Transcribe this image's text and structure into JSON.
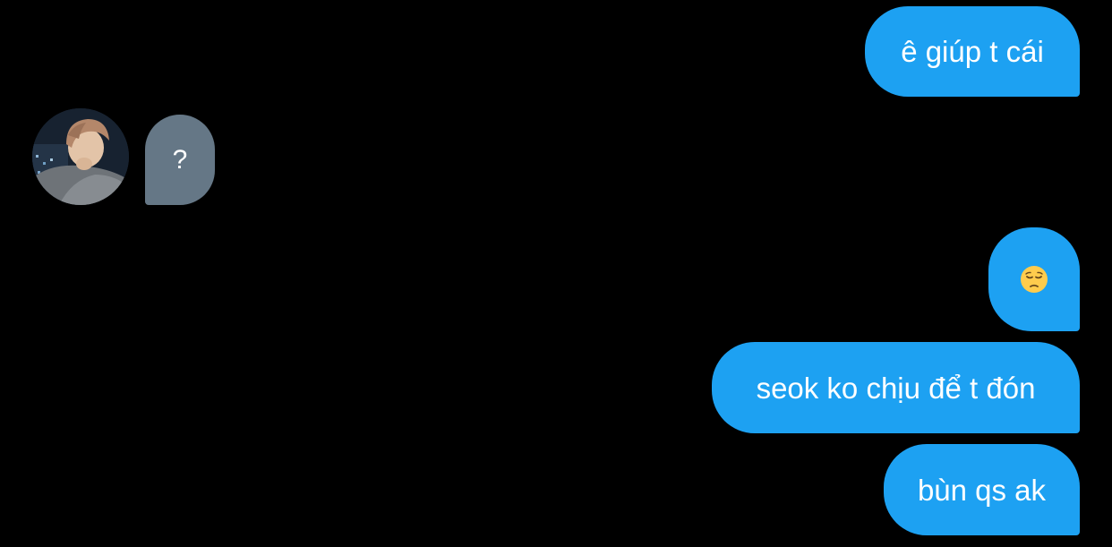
{
  "conversation": {
    "messages": [
      {
        "direction": "outgoing",
        "text": "ê giúp t cái"
      },
      {
        "direction": "incoming",
        "text": "?",
        "sender_avatar": "user-avatar-photo"
      },
      {
        "direction": "outgoing",
        "emoji": "pensive-face-icon"
      },
      {
        "direction": "outgoing",
        "text": "seok ko chịu để t đón"
      },
      {
        "direction": "outgoing",
        "text": "bùn qs ak"
      }
    ]
  },
  "colors": {
    "background": "#000000",
    "outgoing_bubble": "#1da1f2",
    "incoming_bubble": "#657786",
    "text": "#ffffff"
  }
}
